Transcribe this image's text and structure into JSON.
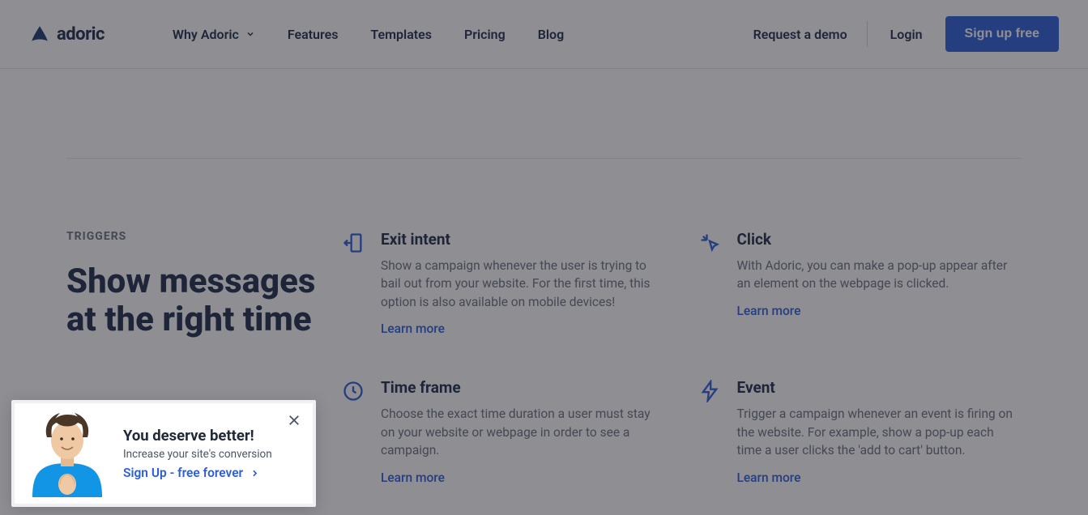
{
  "brand": {
    "name": "adoric"
  },
  "nav": {
    "items": [
      "Why Adoric",
      "Features",
      "Templates",
      "Pricing",
      "Blog"
    ]
  },
  "header": {
    "demo": "Request a demo",
    "login": "Login",
    "signup": "Sign up free"
  },
  "section": {
    "eyebrow": "TRIGGERS",
    "title": "Show messages at the right time"
  },
  "features": [
    {
      "icon": "exit-intent",
      "title": "Exit intent",
      "desc": "Show a campaign whenever the user is trying to bail out from your website. For the first time, this option is also available on mobile devices!",
      "cta": "Learn more"
    },
    {
      "icon": "click",
      "title": "Click",
      "desc": "With Adoric, you can make a pop-up appear after an element on the webpage is clicked.",
      "cta": "Learn more"
    },
    {
      "icon": "time-frame",
      "title": "Time frame",
      "desc": "Choose the exact time duration a user must stay on your website or webpage in order to see a campaign.",
      "cta": "Learn more"
    },
    {
      "icon": "event",
      "title": "Event",
      "desc": "Trigger a campaign whenever an event is firing on the website. For example, show a pop-up each time a user clicks the 'add to cart' button.",
      "cta": "Learn more"
    }
  ],
  "popup": {
    "title": "You deserve better!",
    "subtitle": "Increase your site's conversion",
    "cta": "Sign Up - free forever"
  },
  "colors": {
    "primary": "#2b5fd9",
    "textDark": "#1f2d4a",
    "textMuted": "#6b7280"
  }
}
